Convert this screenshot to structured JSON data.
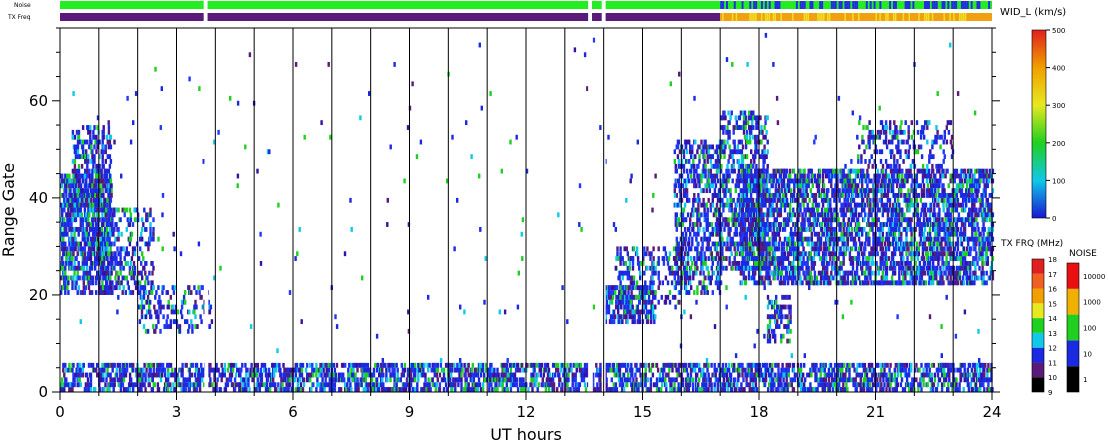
{
  "chart_data": {
    "type": "heatmap",
    "title": "",
    "xlabel": "UT hours",
    "ylabel": "Range Gate",
    "xlim": [
      0,
      24
    ],
    "ylim": [
      0,
      75
    ],
    "x_ticks": [
      "0",
      "3",
      "6",
      "9",
      "12",
      "15",
      "18",
      "21",
      "24"
    ],
    "y_ticks": [
      "0",
      "20",
      "40",
      "60"
    ],
    "grid_x": true,
    "strip_labels": [
      "Noise",
      "TX Freq"
    ],
    "noise_strip_segments": [
      {
        "from": 0.0,
        "to": 3.7,
        "level": "100"
      },
      {
        "from": 3.8,
        "to": 13.6,
        "level": "100"
      },
      {
        "from": 13.7,
        "to": 13.95,
        "level": "100"
      },
      {
        "from": 14.05,
        "to": 17.0,
        "level": "100"
      },
      {
        "from": 17.0,
        "to": 24.0,
        "level": "100/10 mixed"
      }
    ],
    "txfreq_strip_segments": [
      {
        "from": 0.0,
        "to": 3.7,
        "freq_mhz": 10
      },
      {
        "from": 3.8,
        "to": 13.6,
        "freq_mhz": 10
      },
      {
        "from": 13.7,
        "to": 13.95,
        "freq_mhz": 10
      },
      {
        "from": 14.05,
        "to": 17.0,
        "freq_mhz": 10
      },
      {
        "from": 17.0,
        "to": 24.0,
        "freq_mhz": 14.5
      }
    ],
    "velocity_colorbar": {
      "label": "WID_L (km/s)",
      "ticks": [
        "0",
        "100",
        "200",
        "300",
        "400",
        "500"
      ],
      "range": [
        0,
        500
      ]
    },
    "txfreq_colorbar": {
      "label": "TX FRQ (MHz)",
      "ticks": [
        "9",
        "10",
        "11",
        "12",
        "13",
        "14",
        "15",
        "16",
        "17",
        "18"
      ],
      "colors": [
        "#000000",
        "#5a1a7a",
        "#1a2ae0",
        "#10c8e8",
        "#20d020",
        "#e8e820",
        "#f0a000",
        "#f06020",
        "#e02020"
      ]
    },
    "noise_colorbar": {
      "label": "NOISE",
      "ticks": [
        "1",
        "10",
        "100",
        "1000",
        "10000"
      ],
      "colors": [
        "#000000",
        "#1a2ae0",
        "#20d020",
        "#f0b000",
        "#e81010"
      ]
    },
    "echo_regions": [
      {
        "x0": 0.0,
        "x1": 24.0,
        "g0": 0,
        "g1": 6,
        "density": 0.75
      },
      {
        "x0": 0.0,
        "x1": 1.3,
        "g0": 20,
        "g1": 45,
        "density": 0.85
      },
      {
        "x0": 0.3,
        "x1": 1.3,
        "g0": 35,
        "g1": 55,
        "density": 0.55
      },
      {
        "x0": 1.0,
        "x1": 2.4,
        "g0": 20,
        "g1": 38,
        "density": 0.45
      },
      {
        "x0": 2.0,
        "x1": 3.9,
        "g0": 12,
        "g1": 22,
        "density": 0.35
      },
      {
        "x0": 14.0,
        "x1": 15.3,
        "g0": 14,
        "g1": 22,
        "density": 0.8
      },
      {
        "x0": 14.3,
        "x1": 16.0,
        "g0": 18,
        "g1": 30,
        "density": 0.4
      },
      {
        "x0": 15.8,
        "x1": 17.0,
        "g0": 20,
        "g1": 52,
        "density": 0.6
      },
      {
        "x0": 17.0,
        "x1": 18.2,
        "g0": 25,
        "g1": 58,
        "density": 0.6
      },
      {
        "x0": 17.5,
        "x1": 24.0,
        "g0": 22,
        "g1": 46,
        "density": 0.8
      },
      {
        "x0": 18.2,
        "x1": 18.8,
        "g0": 10,
        "g1": 20,
        "density": 0.6
      },
      {
        "x0": 20.5,
        "x1": 23.0,
        "g0": 46,
        "g1": 56,
        "density": 0.35
      }
    ]
  }
}
